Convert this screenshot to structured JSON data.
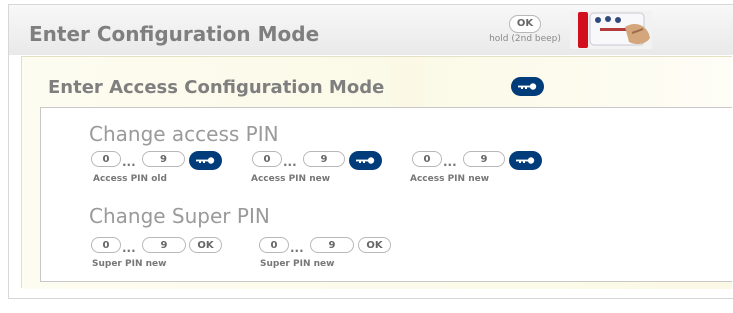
{
  "outer": {
    "title": "Enter Configuration Mode",
    "ok_label": "OK",
    "hold_text": "hold (2nd beep)"
  },
  "inner": {
    "title": "Enter Access Configuration Mode"
  },
  "access_pin": {
    "title": "Change access PIN",
    "groups": [
      {
        "start": "0",
        "end": "9",
        "label": "Access PIN old"
      },
      {
        "start": "0",
        "end": "9",
        "label": "Access PIN new"
      },
      {
        "start": "0",
        "end": "9",
        "label": "Access PIN new"
      }
    ]
  },
  "super_pin": {
    "title": "Change Super PIN",
    "groups": [
      {
        "start": "0",
        "end": "9",
        "ok": "OK",
        "label": "Super PIN new"
      },
      {
        "start": "0",
        "end": "9",
        "ok": "OK",
        "label": "Super PIN new"
      }
    ]
  },
  "dots": "...",
  "icons": {
    "key": "key-icon",
    "device": "device-photo-icon"
  },
  "colors": {
    "title_gray": "#7f7f7f",
    "key_blue": "#003b7a",
    "inner_background": "#fbf9e6"
  }
}
